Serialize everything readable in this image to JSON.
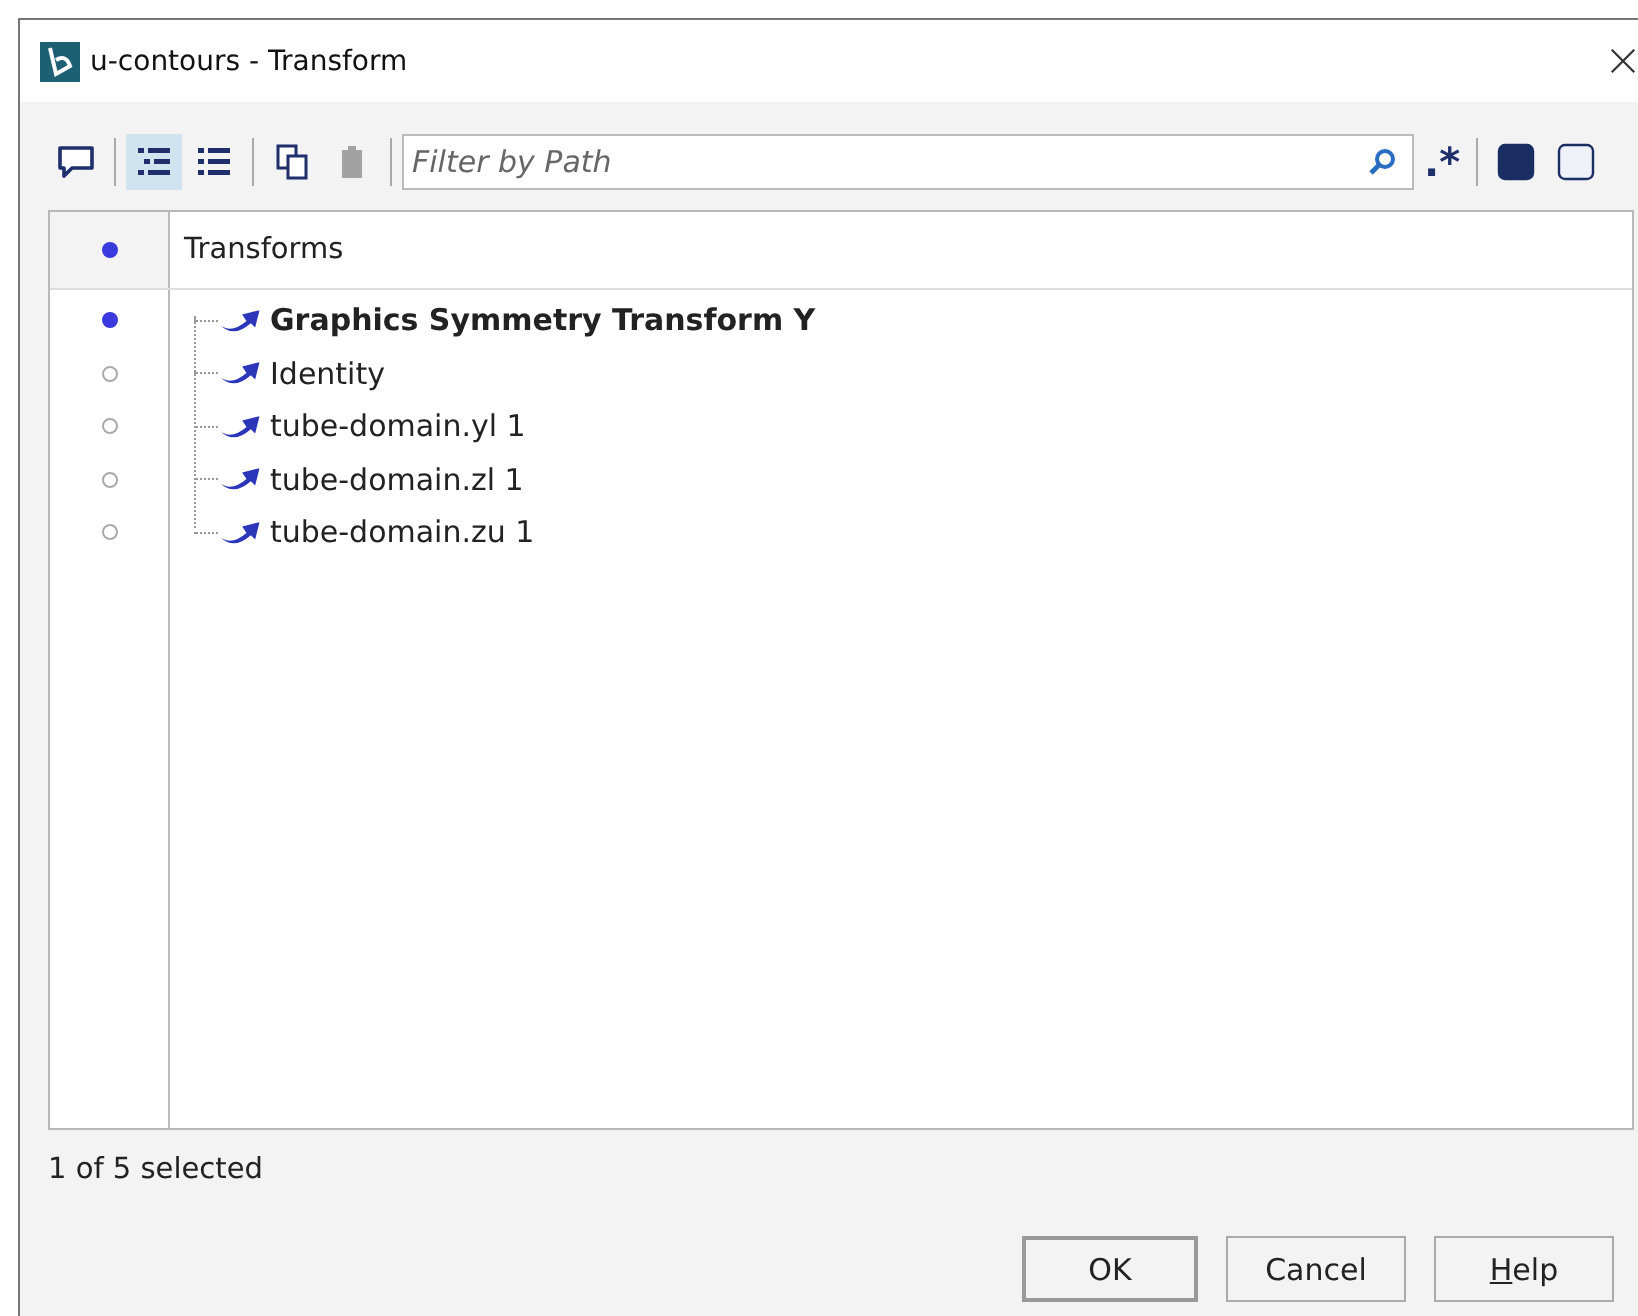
{
  "window": {
    "title": "u-contours - Transform"
  },
  "toolbar": [
    {
      "kind": "comment",
      "selected": false,
      "disabled": false
    },
    {
      "kind": "tree",
      "selected": true,
      "disabled": false
    },
    {
      "kind": "list",
      "selected": false,
      "disabled": false
    },
    {
      "kind": "copy",
      "selected": false,
      "disabled": false
    },
    {
      "kind": "paste",
      "selected": false,
      "disabled": true
    }
  ],
  "filter": {
    "placeholder": "Filter by Path",
    "regex_label": ".*"
  },
  "view_buttons": [
    {
      "kind": "filled",
      "selected": false
    },
    {
      "kind": "empty",
      "selected": false
    }
  ],
  "table": {
    "column": "Transforms",
    "rows": [
      {
        "label": "Graphics Symmetry Transform Y",
        "selected": true
      },
      {
        "label": "Identity",
        "selected": false
      },
      {
        "label": "tube-domain.yl 1",
        "selected": false
      },
      {
        "label": "tube-domain.zl 1",
        "selected": false
      },
      {
        "label": "tube-domain.zu 1",
        "selected": false
      }
    ]
  },
  "status": "1 of 5 selected",
  "buttons": [
    "OK",
    "Cancel",
    "Help"
  ]
}
